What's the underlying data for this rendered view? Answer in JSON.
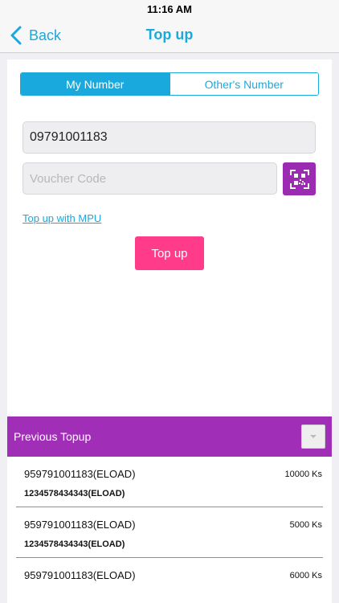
{
  "status_bar": {
    "time": "11:16 AM"
  },
  "nav": {
    "back_label": "Back",
    "title": "Top up"
  },
  "tabs": {
    "my_number": "My Number",
    "others_number": "Other's Number",
    "selected": "My Number"
  },
  "form": {
    "phone_value": "09791001183",
    "voucher_placeholder": "Voucher Code",
    "mpu_link": "Top up with MPU",
    "topup_button": "Top up"
  },
  "previous": {
    "title": "Previous Topup",
    "items": [
      {
        "number": "959791001183(ELOAD)",
        "sub_number": "1234578434343(ELOAD)",
        "amount": "10000 Ks"
      },
      {
        "number": "959791001183(ELOAD)",
        "sub_number": "1234578434343(ELOAD)",
        "amount": "5000 Ks"
      },
      {
        "number": "959791001183(ELOAD)",
        "sub_number": "",
        "amount": "6000 Ks"
      }
    ]
  },
  "colors": {
    "accent": "#1aa9dc",
    "purple": "#a12eb7",
    "pink": "#ff3b8a"
  },
  "icons": {
    "back": "chevron-left-icon",
    "qr": "qr-code-icon",
    "toggle": "caret-down-icon"
  }
}
